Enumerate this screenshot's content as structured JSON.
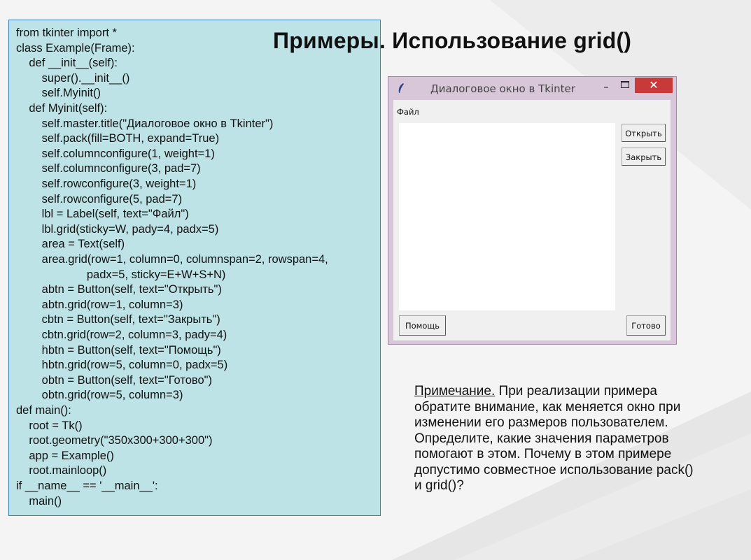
{
  "slide": {
    "title": "Примеры. Использование grid()"
  },
  "code": {
    "lines": [
      "from tkinter import *",
      "class Example(Frame):",
      "    def __init__(self):",
      "        super().__init__()",
      "        self.Myinit()",
      "    def Myinit(self):",
      "        self.master.title(\"Диалоговое окно в Tkinter\")",
      "        self.pack(fill=BOTH, expand=True)",
      "        self.columnconfigure(1, weight=1)",
      "        self.columnconfigure(3, pad=7)",
      "        self.rowconfigure(3, weight=1)",
      "        self.rowconfigure(5, pad=7)",
      "        lbl = Label(self, text=\"Файл\")",
      "        lbl.grid(sticky=W, pady=4, padx=5)",
      "        area = Text(self)",
      "        area.grid(row=1, column=0, columnspan=2, rowspan=4,",
      "                      padx=5, sticky=E+W+S+N)",
      "        abtn = Button(self, text=\"Открыть\")",
      "        abtn.grid(row=1, column=3)",
      "        cbtn = Button(self, text=\"Закрыть\")",
      "        cbtn.grid(row=2, column=3, pady=4)",
      "        hbtn = Button(self, text=\"Помощь\")",
      "        hbtn.grid(row=5, column=0, padx=5)",
      "        obtn = Button(self, text=\"Готово\")",
      "        obtn.grid(row=5, column=3)",
      "def main():",
      "    root = Tk()",
      "    root.geometry(\"350x300+300+300\")",
      "    app = Example()",
      "    root.mainloop()",
      "if __name__ == '__main__':",
      "    main()"
    ]
  },
  "window": {
    "title": "Диалоговое окно в Tkinter",
    "minimize": "–",
    "close": "✕",
    "label": "Файл",
    "buttons": {
      "open": "Открыть",
      "close": "Закрыть",
      "help": "Помощь",
      "done": "Готово"
    },
    "icons": {
      "app": "feather-icon",
      "minimize": "minimize-icon",
      "maximize": "maximize-icon",
      "close": "close-icon"
    }
  },
  "note": {
    "heading": "Примечание.",
    "text": " При реализации примера обратите внимание, как меняется окно при изменении его размеров пользователем. Определите, какие значения параметров помогают в этом. Почему в этом примере допустимо совместное использование pack() и grid()?"
  },
  "colors": {
    "code_bg": "#bde3e7",
    "code_border": "#3a7fb8",
    "window_frame": "#d8c6d9",
    "close_button": "#c8393a"
  }
}
